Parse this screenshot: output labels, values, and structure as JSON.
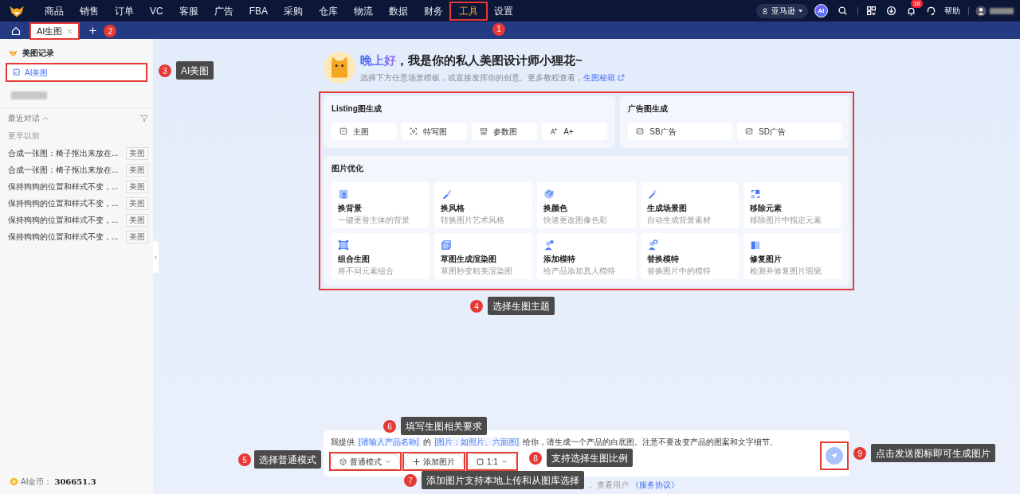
{
  "top_nav": {
    "items": [
      {
        "label": "商品",
        "selected": false
      },
      {
        "label": "销售",
        "selected": false
      },
      {
        "label": "订单",
        "selected": false
      },
      {
        "label": "VC",
        "selected": false
      },
      {
        "label": "客服",
        "selected": false
      },
      {
        "label": "广告",
        "selected": false
      },
      {
        "label": "FBA",
        "selected": false
      },
      {
        "label": "采购",
        "selected": false
      },
      {
        "label": "仓库",
        "selected": false
      },
      {
        "label": "物流",
        "selected": false
      },
      {
        "label": "数据",
        "selected": false
      },
      {
        "label": "财务",
        "selected": false
      },
      {
        "label": "工具",
        "selected": true
      },
      {
        "label": "设置",
        "selected": false
      }
    ],
    "marketplace": "亚马逊",
    "ai_badge": "AI",
    "notification_count": "38",
    "help": "帮助"
  },
  "tabs": [
    {
      "label": "AI生图",
      "selected": true
    }
  ],
  "sidebar": {
    "title": "美图记录",
    "items": [
      {
        "label": "AI美图",
        "selected": true
      }
    ],
    "recent_title": "最近对话",
    "section": "更早以前",
    "history": [
      {
        "text": "合成一张图：椅子抠出来放在...",
        "tag": "美图"
      },
      {
        "text": "合成一张图：椅子抠出来放在...",
        "tag": "美图"
      },
      {
        "text": "保持狗狗的位置和样式不变，...",
        "tag": "美图"
      },
      {
        "text": "保持狗狗的位置和样式不变，...",
        "tag": "美图"
      },
      {
        "text": "保持狗狗的位置和样式不变，...",
        "tag": "美图"
      },
      {
        "text": "保持狗狗的位置和样式不变，...",
        "tag": "美图"
      }
    ],
    "coins_label": "AI金币：",
    "coins": "306651.3"
  },
  "greeting": {
    "hello": "晚上好",
    "title": "，我是你的私人美图设计师小狸花~",
    "subtitle": "选择下方任意场景模板，或直接发挥你的创意。更多教程查看，",
    "link": "生图秘籍"
  },
  "listing": {
    "title": "Listing图生成",
    "options": [
      "主图",
      "特写图",
      "参数图",
      "A+"
    ]
  },
  "ads": {
    "title": "广告图生成",
    "options": [
      "SB广告",
      "SD广告"
    ]
  },
  "optimize": {
    "title": "图片优化",
    "cards": [
      {
        "title": "换背景",
        "desc": "一键更替主体的背景"
      },
      {
        "title": "换风格",
        "desc": "转换图片艺术风格"
      },
      {
        "title": "换颜色",
        "desc": "快速更改图像色彩"
      },
      {
        "title": "生成场景图",
        "desc": "自动生成背景素材"
      },
      {
        "title": "移除元素",
        "desc": "移除图片中指定元素"
      },
      {
        "title": "组合生图",
        "desc": "将不同元素组合"
      },
      {
        "title": "草图生成渲染图",
        "desc": "草图秒变精美渲染图"
      },
      {
        "title": "添加模特",
        "desc": "给产品添加真人模特"
      },
      {
        "title": "替换模特",
        "desc": "替换图片中的模特"
      },
      {
        "title": "修复图片",
        "desc": "检测并修复图片瑕疵"
      }
    ]
  },
  "prompt": {
    "parts": [
      {
        "kind": "text",
        "text": "我提供"
      },
      {
        "kind": "slot",
        "text": "[请输入产品名称]"
      },
      {
        "kind": "text",
        "text": "的"
      },
      {
        "kind": "slot",
        "text": "[图片：如照片、六面图]"
      },
      {
        "kind": "text",
        "text": "给你，请生成一个产品的白底图。注意不要改变产品的图案和文字细节。"
      }
    ],
    "mode": "普通模式",
    "add_image": "添加图片",
    "ratio": "1:1"
  },
  "footer": {
    "text": "。查看用户",
    "link": "《服务协议》"
  },
  "annotations": [
    {
      "number": "1"
    },
    {
      "number": "2"
    },
    {
      "number": "3",
      "text": "AI美图"
    },
    {
      "number": "4",
      "text": "选择生图主题"
    },
    {
      "number": "5",
      "text": "选择普通模式"
    },
    {
      "number": "6",
      "text": "填写生图相关要求"
    },
    {
      "number": "7",
      "text": "添加图片支持本地上传和从图库选择"
    },
    {
      "number": "8",
      "text": "支持选择生图比例"
    },
    {
      "number": "9",
      "text": "点击发送图标即可生成图片"
    }
  ]
}
